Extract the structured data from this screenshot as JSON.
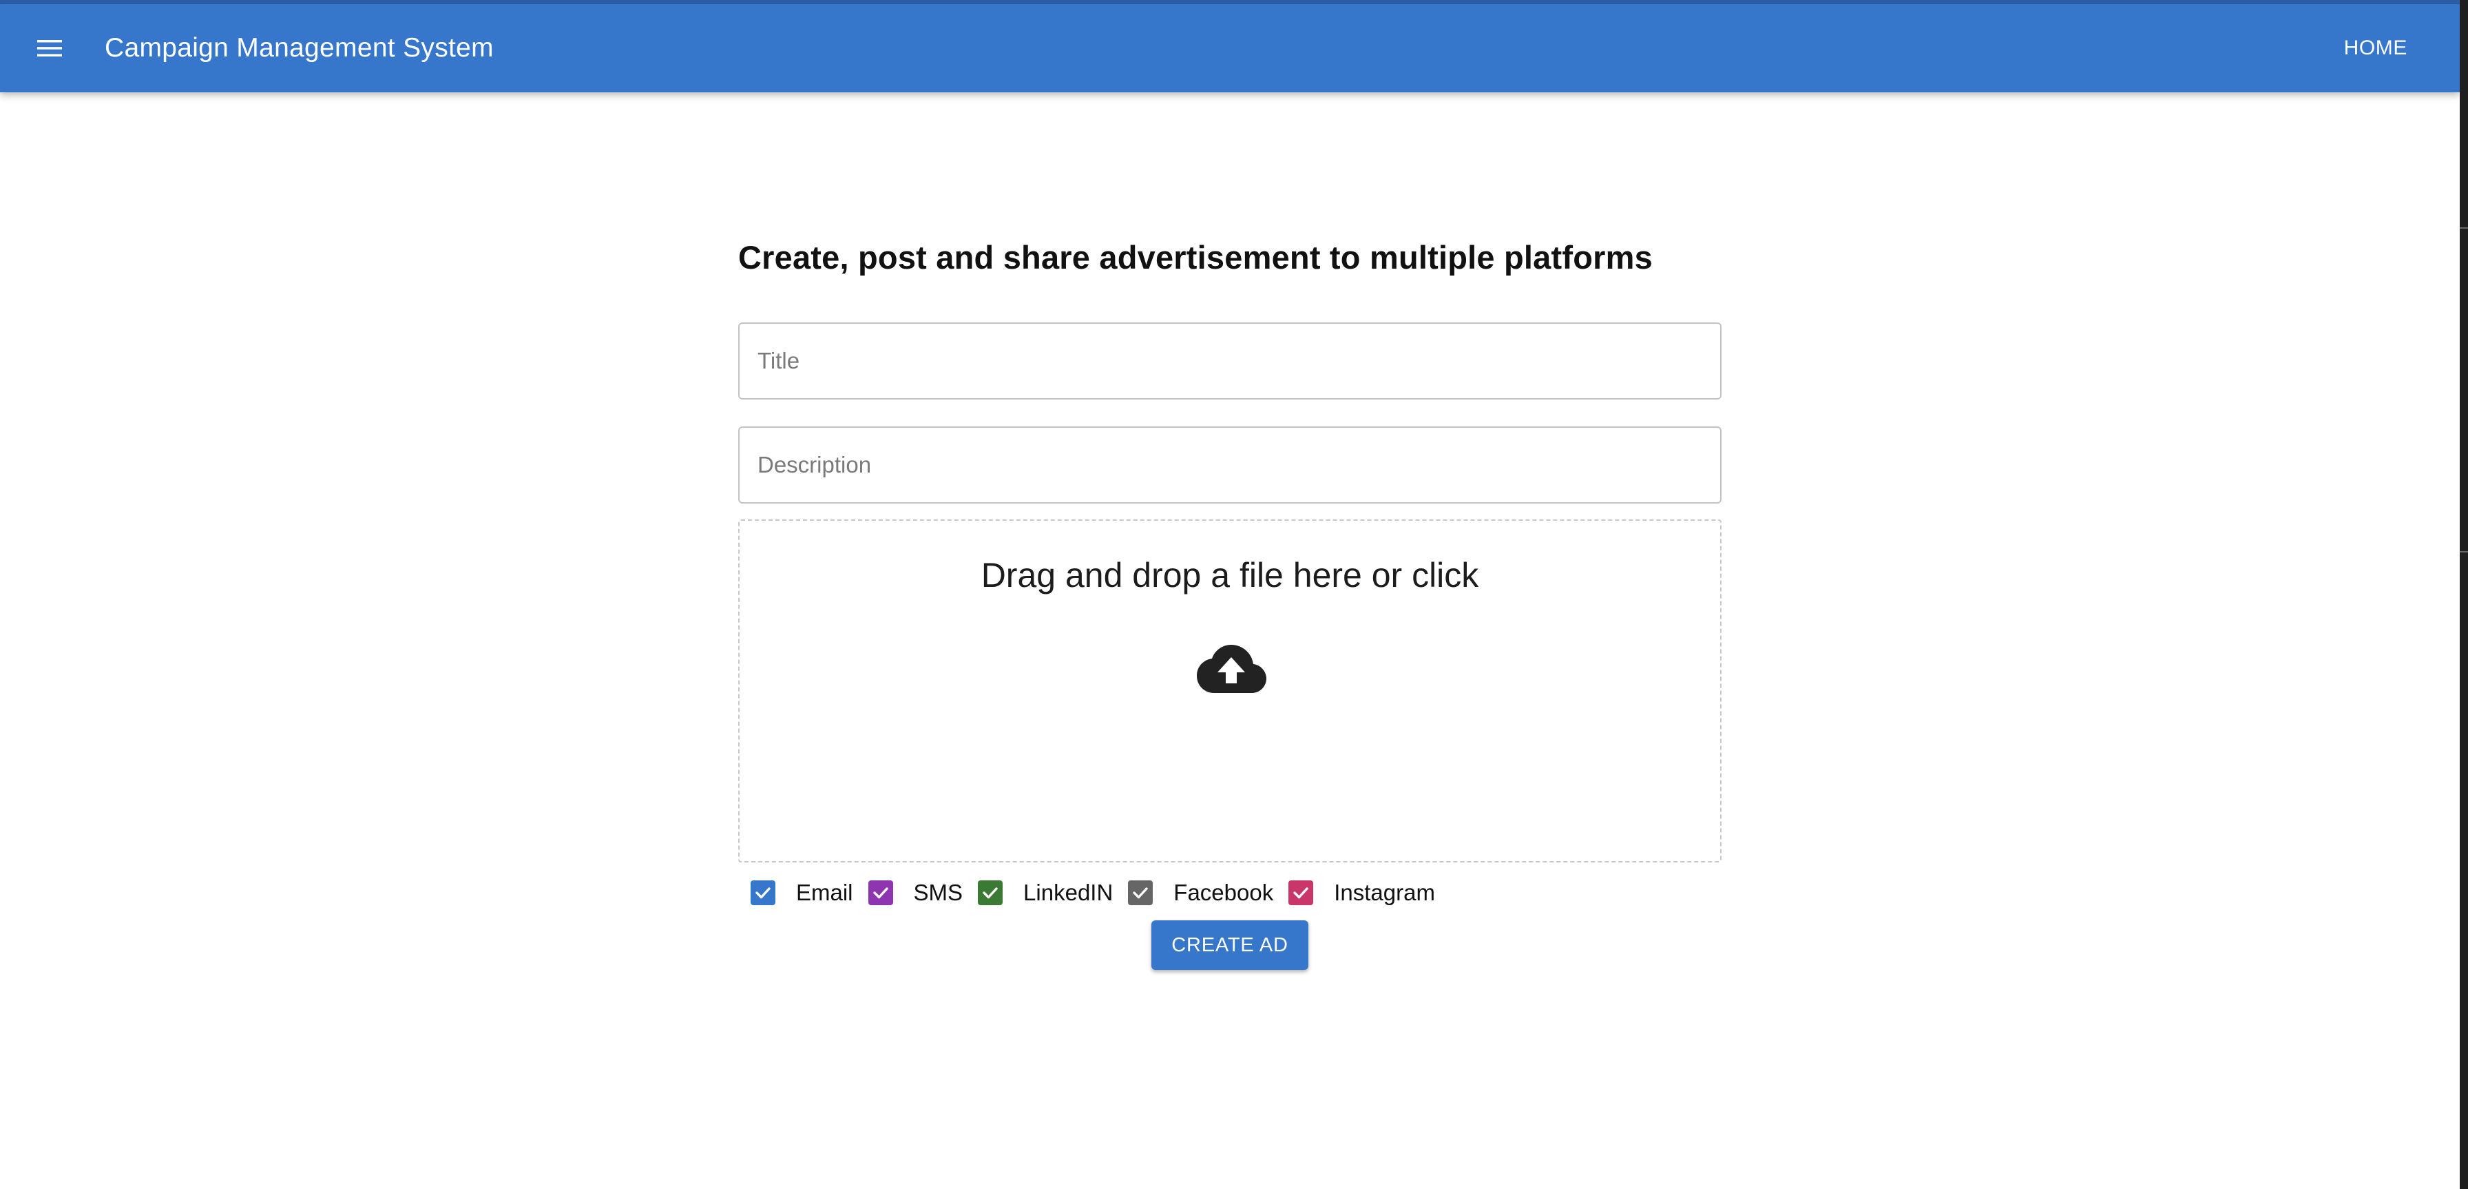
{
  "appbar": {
    "title": "Campaign Management System",
    "home_label": "HOME",
    "color": "#3677cc",
    "menu_icon": "menu-icon"
  },
  "form": {
    "heading": "Create, post and share advertisement to multiple platforms",
    "title_placeholder": "Title",
    "title_value": "",
    "description_placeholder": "Description",
    "description_value": "",
    "dropzone_text": "Drag and drop a file here or click",
    "dropzone_icon": "cloud-upload-icon",
    "channels": [
      {
        "label": "Email",
        "checked": true,
        "color": "#3677cc"
      },
      {
        "label": "SMS",
        "checked": true,
        "color": "#8e35b0"
      },
      {
        "label": "LinkedIN",
        "checked": true,
        "color": "#3a7a34"
      },
      {
        "label": "Facebook",
        "checked": true,
        "color": "#666666"
      },
      {
        "label": "Instagram",
        "checked": true,
        "color": "#c8366a"
      }
    ],
    "submit_label": "CREATE AD"
  }
}
